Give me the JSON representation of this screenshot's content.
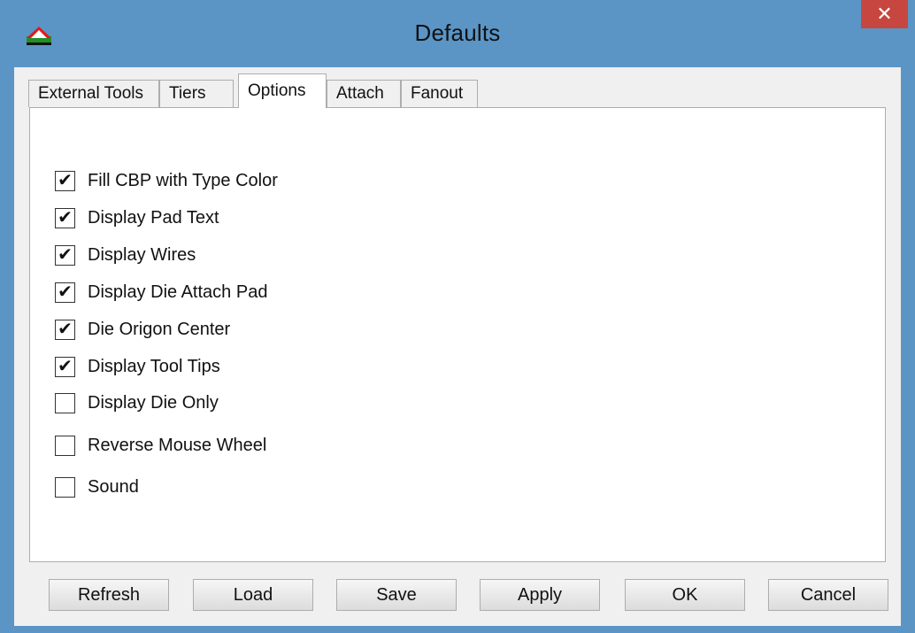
{
  "window": {
    "title": "Defaults",
    "close_glyph": "✕",
    "accent": "#5b95c6",
    "close_color": "#c7463f"
  },
  "tabs": [
    {
      "label": "External Tools",
      "active": false
    },
    {
      "label": "Tiers",
      "active": false
    },
    {
      "label": "Options",
      "active": true
    },
    {
      "label": "Attach",
      "active": false
    },
    {
      "label": "Fanout",
      "active": false
    }
  ],
  "options": [
    {
      "label": "Fill CBP with Type Color",
      "checked": true
    },
    {
      "label": "Display Pad Text",
      "checked": true
    },
    {
      "label": "Display Wires",
      "checked": true
    },
    {
      "label": "Display Die Attach Pad",
      "checked": true
    },
    {
      "label": "Die Origon Center",
      "checked": true
    },
    {
      "label": "Display Tool Tips",
      "checked": true
    },
    {
      "label": "Display Die Only",
      "checked": false
    },
    {
      "label": "Reverse Mouse Wheel",
      "checked": false
    },
    {
      "label": "Sound",
      "checked": false
    }
  ],
  "buttons": {
    "refresh": "Refresh",
    "load": "Load",
    "save": "Save",
    "apply": "Apply",
    "ok": "OK",
    "cancel": "Cancel"
  },
  "check_glyph": "✔"
}
